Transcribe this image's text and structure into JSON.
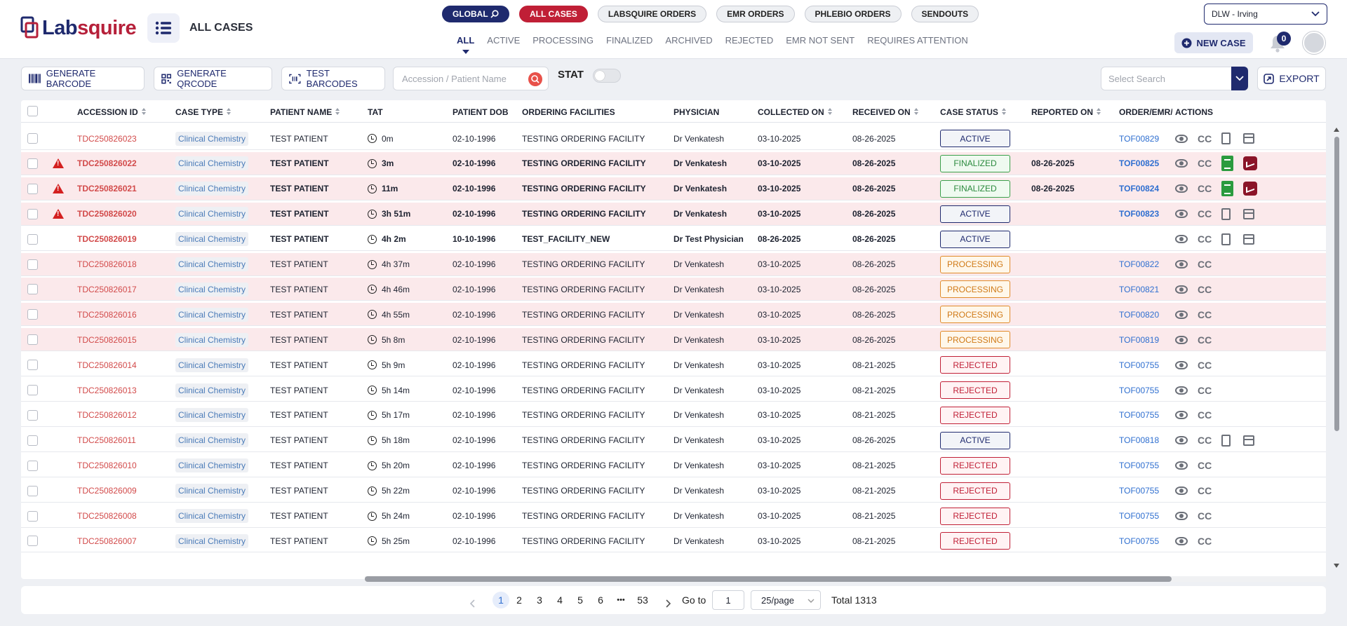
{
  "brand": {
    "name_a": "Lab",
    "name_b": "squire"
  },
  "header": {
    "title": "ALL CASES",
    "pills": [
      "GLOBAL",
      "ALL CASES",
      "LABSQUIRE ORDERS",
      "EMR ORDERS",
      "PHLEBIO ORDERS",
      "SENDOUTS"
    ],
    "tabs": [
      "ALL",
      "ACTIVE",
      "PROCESSING",
      "FINALIZED",
      "ARCHIVED",
      "REJECTED",
      "EMR NOT SENT",
      "REQUIRES ATTENTION"
    ],
    "location": "DLW - Irving",
    "new_case": "NEW CASE",
    "notifications": "0"
  },
  "toolbar": {
    "gen_barcode": "GENERATE BARCODE",
    "gen_qrcode": "GENERATE QRCODE",
    "test_barcodes": "TEST BARCODES",
    "search_placeholder": "Accession / Patient Name",
    "stat": "STAT",
    "select_search_placeholder": "Select Search",
    "export": "EXPORT"
  },
  "columns": [
    "ACCESSION ID",
    "CASE TYPE",
    "PATIENT NAME",
    "TAT",
    "PATIENT DOB",
    "ORDERING FACILITIES",
    "PHYSICIAN",
    "COLLECTED ON",
    "RECEIVED ON",
    "CASE STATUS",
    "REPORTED ON",
    "ORDER/EMR/",
    "ACTIONS"
  ],
  "rows": [
    {
      "acc": "TDC250826023",
      "ctype": "Clinical Chemistry",
      "patient": "TEST PATIENT",
      "tat": "0m",
      "dob": "02-10-1996",
      "facility": "TESTING ORDERING FACILITY",
      "physician": "Dr Venkatesh",
      "collected": "03-10-2025",
      "received": "08-26-2025",
      "status": "ACTIVE",
      "reported": "",
      "order": "TOF00829",
      "pink": false,
      "bold": false,
      "warn": false,
      "actions": "full"
    },
    {
      "acc": "TDC250826022",
      "ctype": "Clinical Chemistry",
      "patient": "TEST PATIENT",
      "tat": "3m",
      "dob": "02-10-1996",
      "facility": "TESTING ORDERING FACILITY",
      "physician": "Dr Venkatesh",
      "collected": "03-10-2025",
      "received": "08-26-2025",
      "status": "FINALIZED",
      "reported": "08-26-2025",
      "order": "TOF00825",
      "pink": true,
      "bold": true,
      "warn": true,
      "actions": "report"
    },
    {
      "acc": "TDC250826021",
      "ctype": "Clinical Chemistry",
      "patient": "TEST PATIENT",
      "tat": "11m",
      "dob": "02-10-1996",
      "facility": "TESTING ORDERING FACILITY",
      "physician": "Dr Venkatesh",
      "collected": "03-10-2025",
      "received": "08-26-2025",
      "status": "FINALIZED",
      "reported": "08-26-2025",
      "order": "TOF00824",
      "pink": true,
      "bold": true,
      "warn": true,
      "actions": "report"
    },
    {
      "acc": "TDC250826020",
      "ctype": "Clinical Chemistry",
      "patient": "TEST PATIENT",
      "tat": "3h 51m",
      "dob": "02-10-1996",
      "facility": "TESTING ORDERING FACILITY",
      "physician": "Dr Venkatesh",
      "collected": "03-10-2025",
      "received": "08-26-2025",
      "status": "ACTIVE",
      "reported": "",
      "order": "TOF00823",
      "pink": true,
      "bold": true,
      "warn": true,
      "actions": "full"
    },
    {
      "acc": "TDC250826019",
      "ctype": "Clinical Chemistry",
      "patient": "TEST PATIENT",
      "tat": "4h 2m",
      "dob": "10-10-1996",
      "facility": "TEST_FACILITY_NEW",
      "physician": "Dr Test Physician",
      "collected": "08-26-2025",
      "received": "08-26-2025",
      "status": "ACTIVE",
      "reported": "",
      "order": "",
      "pink": false,
      "bold": true,
      "warn": false,
      "actions": "full"
    },
    {
      "acc": "TDC250826018",
      "ctype": "Clinical Chemistry",
      "patient": "TEST PATIENT",
      "tat": "4h 37m",
      "dob": "02-10-1996",
      "facility": "TESTING ORDERING FACILITY",
      "physician": "Dr Venkatesh",
      "collected": "03-10-2025",
      "received": "08-26-2025",
      "status": "PROCESSING",
      "reported": "",
      "order": "TOF00822",
      "pink": true,
      "bold": false,
      "warn": false,
      "actions": "basic"
    },
    {
      "acc": "TDC250826017",
      "ctype": "Clinical Chemistry",
      "patient": "TEST PATIENT",
      "tat": "4h 46m",
      "dob": "02-10-1996",
      "facility": "TESTING ORDERING FACILITY",
      "physician": "Dr Venkatesh",
      "collected": "03-10-2025",
      "received": "08-26-2025",
      "status": "PROCESSING",
      "reported": "",
      "order": "TOF00821",
      "pink": true,
      "bold": false,
      "warn": false,
      "actions": "basic"
    },
    {
      "acc": "TDC250826016",
      "ctype": "Clinical Chemistry",
      "patient": "TEST PATIENT",
      "tat": "4h 55m",
      "dob": "02-10-1996",
      "facility": "TESTING ORDERING FACILITY",
      "physician": "Dr Venkatesh",
      "collected": "03-10-2025",
      "received": "08-26-2025",
      "status": "PROCESSING",
      "reported": "",
      "order": "TOF00820",
      "pink": true,
      "bold": false,
      "warn": false,
      "actions": "basic"
    },
    {
      "acc": "TDC250826015",
      "ctype": "Clinical Chemistry",
      "patient": "TEST PATIENT",
      "tat": "5h 8m",
      "dob": "02-10-1996",
      "facility": "TESTING ORDERING FACILITY",
      "physician": "Dr Venkatesh",
      "collected": "03-10-2025",
      "received": "08-26-2025",
      "status": "PROCESSING",
      "reported": "",
      "order": "TOF00819",
      "pink": true,
      "bold": false,
      "warn": false,
      "actions": "basic"
    },
    {
      "acc": "TDC250826014",
      "ctype": "Clinical Chemistry",
      "patient": "TEST PATIENT",
      "tat": "5h 9m",
      "dob": "02-10-1996",
      "facility": "TESTING ORDERING FACILITY",
      "physician": "Dr Venkatesh",
      "collected": "03-10-2025",
      "received": "08-21-2025",
      "status": "REJECTED",
      "reported": "",
      "order": "TOF00755",
      "pink": false,
      "bold": false,
      "warn": false,
      "actions": "basic"
    },
    {
      "acc": "TDC250826013",
      "ctype": "Clinical Chemistry",
      "patient": "TEST PATIENT",
      "tat": "5h 14m",
      "dob": "02-10-1996",
      "facility": "TESTING ORDERING FACILITY",
      "physician": "Dr Venkatesh",
      "collected": "03-10-2025",
      "received": "08-21-2025",
      "status": "REJECTED",
      "reported": "",
      "order": "TOF00755",
      "pink": false,
      "bold": false,
      "warn": false,
      "actions": "basic"
    },
    {
      "acc": "TDC250826012",
      "ctype": "Clinical Chemistry",
      "patient": "TEST PATIENT",
      "tat": "5h 17m",
      "dob": "02-10-1996",
      "facility": "TESTING ORDERING FACILITY",
      "physician": "Dr Venkatesh",
      "collected": "03-10-2025",
      "received": "08-21-2025",
      "status": "REJECTED",
      "reported": "",
      "order": "TOF00755",
      "pink": false,
      "bold": false,
      "warn": false,
      "actions": "basic"
    },
    {
      "acc": "TDC250826011",
      "ctype": "Clinical Chemistry",
      "patient": "TEST PATIENT",
      "tat": "5h 18m",
      "dob": "02-10-1996",
      "facility": "TESTING ORDERING FACILITY",
      "physician": "Dr Venkatesh",
      "collected": "03-10-2025",
      "received": "08-26-2025",
      "status": "ACTIVE",
      "reported": "",
      "order": "TOF00818",
      "pink": false,
      "bold": false,
      "warn": false,
      "actions": "full"
    },
    {
      "acc": "TDC250826010",
      "ctype": "Clinical Chemistry",
      "patient": "TEST PATIENT",
      "tat": "5h 20m",
      "dob": "02-10-1996",
      "facility": "TESTING ORDERING FACILITY",
      "physician": "Dr Venkatesh",
      "collected": "03-10-2025",
      "received": "08-21-2025",
      "status": "REJECTED",
      "reported": "",
      "order": "TOF00755",
      "pink": false,
      "bold": false,
      "warn": false,
      "actions": "basic"
    },
    {
      "acc": "TDC250826009",
      "ctype": "Clinical Chemistry",
      "patient": "TEST PATIENT",
      "tat": "5h 22m",
      "dob": "02-10-1996",
      "facility": "TESTING ORDERING FACILITY",
      "physician": "Dr Venkatesh",
      "collected": "03-10-2025",
      "received": "08-21-2025",
      "status": "REJECTED",
      "reported": "",
      "order": "TOF00755",
      "pink": false,
      "bold": false,
      "warn": false,
      "actions": "basic"
    },
    {
      "acc": "TDC250826008",
      "ctype": "Clinical Chemistry",
      "patient": "TEST PATIENT",
      "tat": "5h 24m",
      "dob": "02-10-1996",
      "facility": "TESTING ORDERING FACILITY",
      "physician": "Dr Venkatesh",
      "collected": "03-10-2025",
      "received": "08-21-2025",
      "status": "REJECTED",
      "reported": "",
      "order": "TOF00755",
      "pink": false,
      "bold": false,
      "warn": false,
      "actions": "basic"
    },
    {
      "acc": "TDC250826007",
      "ctype": "Clinical Chemistry",
      "patient": "TEST PATIENT",
      "tat": "5h 25m",
      "dob": "02-10-1996",
      "facility": "TESTING ORDERING FACILITY",
      "physician": "Dr Venkatesh",
      "collected": "03-10-2025",
      "received": "08-21-2025",
      "status": "REJECTED",
      "reported": "",
      "order": "TOF00755",
      "pink": false,
      "bold": false,
      "warn": false,
      "actions": "basic"
    }
  ],
  "pagination": {
    "pages": [
      "1",
      "2",
      "3",
      "4",
      "5",
      "6",
      "•••",
      "53"
    ],
    "current": "1",
    "goto_label": "Go to",
    "goto_value": "1",
    "per_page": "25/page",
    "total": "Total 1313"
  },
  "colors": {
    "brand_red": "#c01f36",
    "brand_navy": "#1f2a6e",
    "link_blue": "#2f6fd0"
  }
}
